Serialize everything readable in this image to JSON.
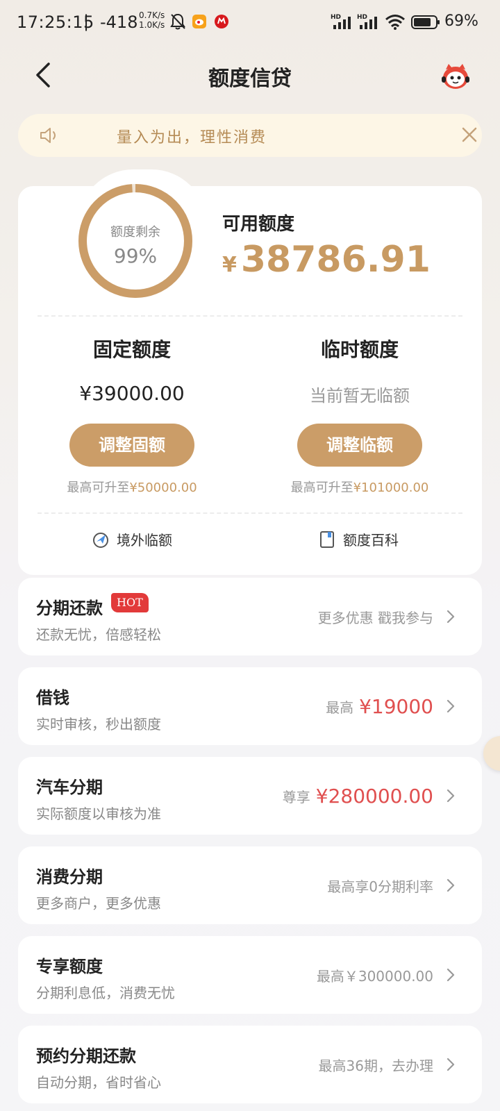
{
  "status_bar": {
    "time": "17:25:15",
    "separator": "|",
    "number": "-418",
    "speed_up": "0.7K/s",
    "speed_down": "1.0K/s",
    "battery": "69%"
  },
  "header": {
    "title": "额度信贷"
  },
  "notice": {
    "text": "量入为出，理性消费"
  },
  "credit": {
    "ring_label": "额度剩余",
    "ring_percent": "99%",
    "ring_fraction": 0.99,
    "available_label": "可用额度",
    "available_currency": "¥",
    "available_amount": "38786.91",
    "fixed": {
      "title": "固定额度",
      "amount": "¥39000.00",
      "button": "调整固额",
      "max_prefix": "最高可升至",
      "max_value": "¥50000.00"
    },
    "temp": {
      "title": "临时额度",
      "amount": "当前暂无临额",
      "button": "调整临额",
      "max_prefix": "最高可升至",
      "max_value": "¥101000.00"
    },
    "links": {
      "overseas": "境外临额",
      "wiki": "额度百科"
    }
  },
  "items": [
    {
      "title": "分期还款",
      "badge": "HOT",
      "subtitle": "还款无忧，倍感轻松",
      "right_text": "更多优惠 戳我参与",
      "right_value": ""
    },
    {
      "title": "借钱",
      "subtitle": "实时审核，秒出额度",
      "right_text": "最高",
      "right_value": "¥19000"
    },
    {
      "title": "汽车分期",
      "subtitle": "实际额度以审核为准",
      "right_text": "尊享",
      "right_value": "¥280000.00"
    },
    {
      "title": "消费分期",
      "subtitle": "更多商户，更多优惠",
      "right_text": "最高享0分期利率",
      "right_value": ""
    },
    {
      "title": "专享额度",
      "subtitle": "分期利息低，消费无忧",
      "right_text": "最高￥300000.00",
      "right_value": ""
    },
    {
      "title": "预约分期还款",
      "subtitle": "自动分期，省时省心",
      "right_text": "最高36期，去办理",
      "right_value": ""
    }
  ],
  "colors": {
    "gold": "#c89a62",
    "button": "#cb9d68",
    "red": "#e04f4f",
    "notice_bg": "#fdf6e6"
  }
}
